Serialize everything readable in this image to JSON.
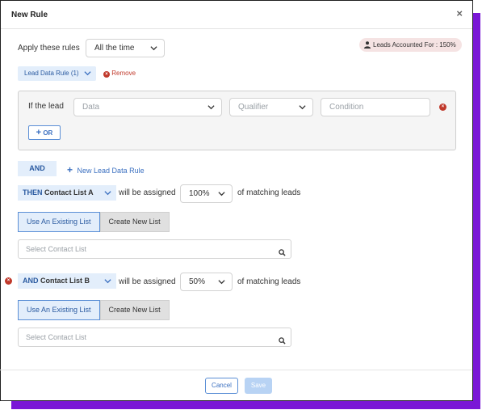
{
  "dialog": {
    "title": "New Rule",
    "close_glyph": "×"
  },
  "apply": {
    "label": "Apply these rules",
    "value": "All the time"
  },
  "leads_badge": {
    "text": "Leads Accounted For :  150%",
    "icon": "user-icon"
  },
  "lead_rule_tag": {
    "label": "Lead Data Rule (1)",
    "remove_label": "Remove"
  },
  "condition": {
    "prefix": "If the lead",
    "data_placeholder": "Data",
    "qualifier_placeholder": "Qualifier",
    "condition_placeholder": "Condition",
    "or_label": "OR"
  },
  "and_label": "AND",
  "new_rule_link": "New Lead Data Rule",
  "assignments": [
    {
      "keyword": "THEN",
      "list_name": "Contact List A",
      "assigned_label": "will be assigned",
      "percent": "100%",
      "suffix": "of matching leads",
      "use_existing": "Use An Existing List",
      "create_new": "Create New List",
      "search_placeholder": "Select Contact List"
    },
    {
      "keyword": "AND",
      "list_name": "Contact List B",
      "assigned_label": "will be assigned",
      "percent": "50%",
      "suffix": "of matching leads",
      "use_existing": "Use An Existing List",
      "create_new": "Create New List",
      "search_placeholder": "Select Contact List"
    }
  ],
  "footer": {
    "cancel": "Cancel",
    "save": "Save"
  },
  "colors": {
    "accent": "#3a6fc0",
    "shadow": "#7a17d6",
    "remove": "#c0392b",
    "badge_bg": "#f5e3e3"
  }
}
